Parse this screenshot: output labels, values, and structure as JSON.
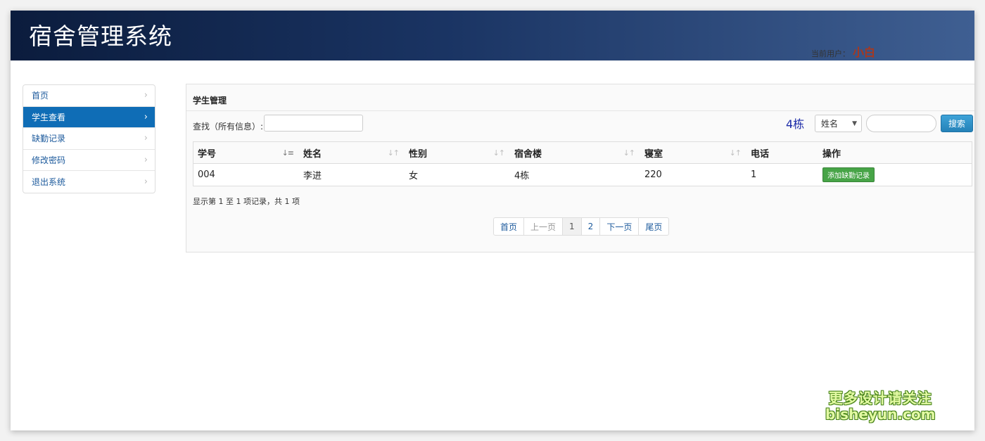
{
  "header": {
    "title": "宿舍管理系统",
    "user_label": "当前用户：",
    "user_name": "小白"
  },
  "sidebar": {
    "items": [
      {
        "label": "首页"
      },
      {
        "label": "学生查看"
      },
      {
        "label": "缺勤记录"
      },
      {
        "label": "修改密码"
      },
      {
        "label": "退出系统"
      }
    ]
  },
  "panel": {
    "title": "学生管理",
    "search_label": "查找（所有信息）:",
    "building": "4栋",
    "field_select": "姓名",
    "search_button": "搜索"
  },
  "table": {
    "columns": [
      "学号",
      "姓名",
      "性别",
      "宿舍楼",
      "寝室",
      "电话",
      "操作"
    ],
    "rows": [
      {
        "id": "004",
        "name": "李进",
        "gender": "女",
        "building": "4栋",
        "room": "220",
        "phone": "1",
        "action": "添加缺勤记录"
      }
    ]
  },
  "info": "显示第 1 至 1 项记录，共 1 项",
  "pagination": {
    "first": "首页",
    "prev": "上一页",
    "pages": [
      "1",
      "2"
    ],
    "next": "下一页",
    "last": "尾页",
    "current": "1"
  },
  "watermark": {
    "line1": "更多设计请关注",
    "line2": "bisheyun.com"
  },
  "colors": {
    "header_dark": "#0b1c3d",
    "accent_blue": "#0f6db6",
    "success_green": "#47a447",
    "user_red": "#a8381f"
  }
}
